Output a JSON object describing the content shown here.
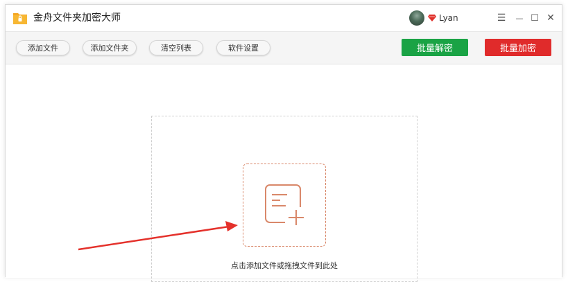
{
  "app": {
    "title": "金舟文件夹加密大师",
    "logo_icon": "folder-lock-icon"
  },
  "user": {
    "name": "Lyan",
    "vip_icon": "diamond-icon"
  },
  "window_controls": {
    "menu": "☰",
    "minimize": "—",
    "maximize": "☐",
    "close": "✕"
  },
  "toolbar": {
    "add_file": "添加文件",
    "add_folder": "添加文件夹",
    "clear_list": "清空列表",
    "settings": "软件设置",
    "batch_decrypt": "批量解密",
    "batch_encrypt": "批量加密"
  },
  "drop_zone": {
    "hint": "点击添加文件或拖拽文件到此处",
    "icon": "add-document-icon"
  },
  "colors": {
    "decrypt_green": "#1aa345",
    "encrypt_red": "#e02b2b",
    "accent_orange": "#d9886a",
    "arrow_red": "#e4312b"
  }
}
